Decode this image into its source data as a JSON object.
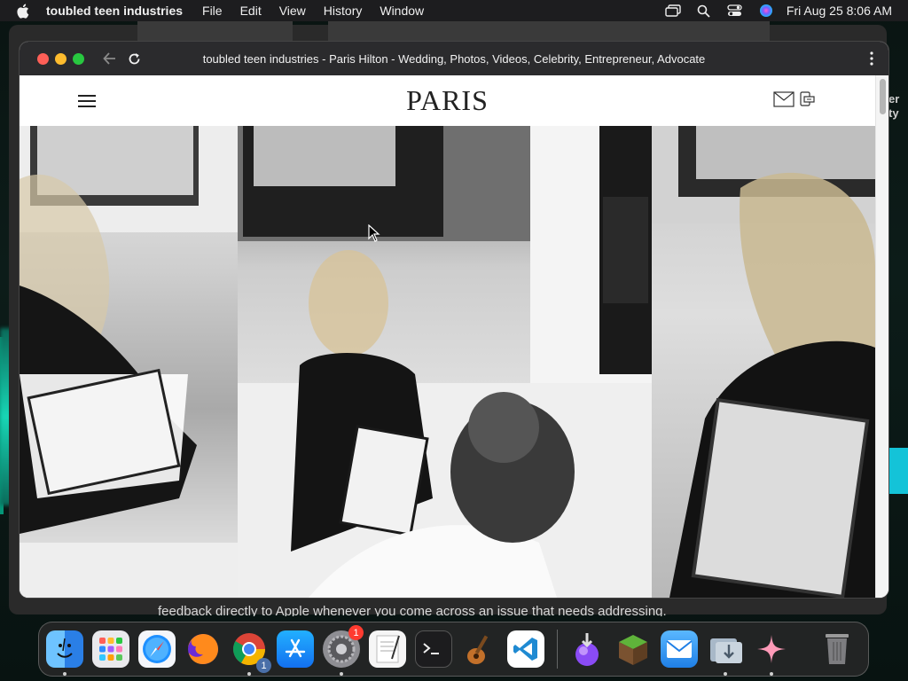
{
  "menubar": {
    "app_name": "toubled teen industries",
    "items": [
      "File",
      "Edit",
      "View",
      "History",
      "Window"
    ],
    "clock": "Fri Aug 25  8:06 AM",
    "icons": [
      "screen-mirroring-icon",
      "search-icon",
      "control-center-icon",
      "siri-icon"
    ]
  },
  "browser": {
    "title": "toubled teen industries - Paris Hilton - Wedding, Photos, Videos, Celebrity, Entrepreneur, Advocate"
  },
  "site": {
    "logo": "PARIS"
  },
  "background": {
    "bottom_text": "feedback directly to Apple whenever you come across an issue that needs addressing.",
    "side_text": "er ty"
  },
  "dock": {
    "apps": [
      {
        "name": "Finder",
        "color": "#2a8cf0"
      },
      {
        "name": "Launchpad",
        "color": "#e8e8e8"
      },
      {
        "name": "Safari",
        "color": "#1e90ff"
      },
      {
        "name": "Firefox",
        "color": "#ff7a1a"
      },
      {
        "name": "Chrome",
        "color": "#ffffff"
      },
      {
        "name": "App Store",
        "color": "#1a8cff"
      },
      {
        "name": "System Settings",
        "color": "#8e8e93"
      },
      {
        "name": "TextEdit",
        "color": "#f4f4f4"
      },
      {
        "name": "Terminal",
        "color": "#1c1c1c"
      },
      {
        "name": "Instruments",
        "color": "#c2702a"
      },
      {
        "name": "VS Code",
        "color": "#ffffff"
      }
    ],
    "badges": {
      "settings": "1",
      "chrome": "1"
    },
    "right_apps": [
      {
        "name": "Installer",
        "color": "#7b3ff2"
      },
      {
        "name": "Minecraft",
        "color": "#5a9b3a"
      },
      {
        "name": "Mail",
        "color": "#3aa0ff"
      },
      {
        "name": "Downloads",
        "color": "#a8b8c8"
      },
      {
        "name": "Sparkle",
        "color": "#ff8fb0"
      },
      {
        "name": "Trash",
        "color": "#9a9a9a"
      }
    ]
  }
}
